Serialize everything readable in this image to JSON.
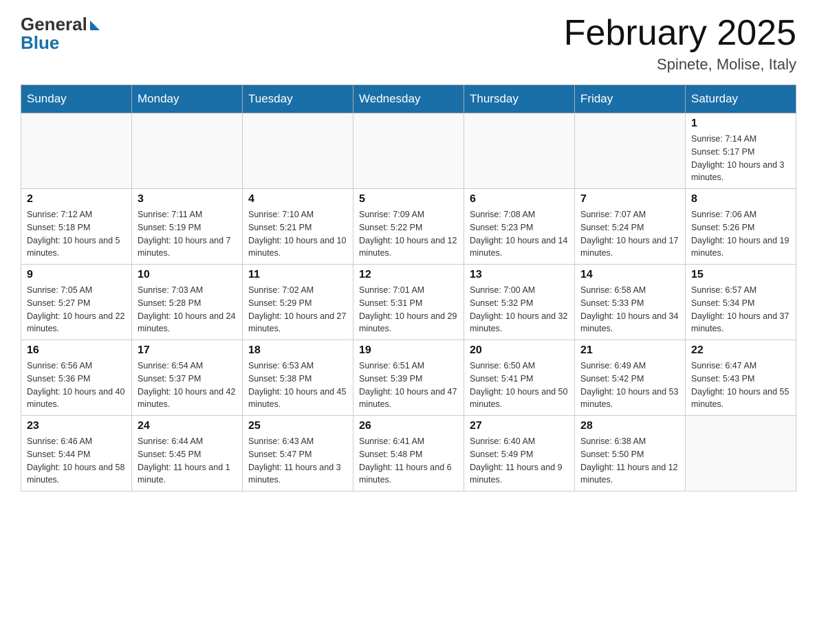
{
  "header": {
    "logo_general": "General",
    "logo_blue": "Blue",
    "month_title": "February 2025",
    "location": "Spinete, Molise, Italy"
  },
  "days_of_week": [
    "Sunday",
    "Monday",
    "Tuesday",
    "Wednesday",
    "Thursday",
    "Friday",
    "Saturday"
  ],
  "weeks": [
    [
      {
        "day": "",
        "info": ""
      },
      {
        "day": "",
        "info": ""
      },
      {
        "day": "",
        "info": ""
      },
      {
        "day": "",
        "info": ""
      },
      {
        "day": "",
        "info": ""
      },
      {
        "day": "",
        "info": ""
      },
      {
        "day": "1",
        "info": "Sunrise: 7:14 AM\nSunset: 5:17 PM\nDaylight: 10 hours and 3 minutes."
      }
    ],
    [
      {
        "day": "2",
        "info": "Sunrise: 7:12 AM\nSunset: 5:18 PM\nDaylight: 10 hours and 5 minutes."
      },
      {
        "day": "3",
        "info": "Sunrise: 7:11 AM\nSunset: 5:19 PM\nDaylight: 10 hours and 7 minutes."
      },
      {
        "day": "4",
        "info": "Sunrise: 7:10 AM\nSunset: 5:21 PM\nDaylight: 10 hours and 10 minutes."
      },
      {
        "day": "5",
        "info": "Sunrise: 7:09 AM\nSunset: 5:22 PM\nDaylight: 10 hours and 12 minutes."
      },
      {
        "day": "6",
        "info": "Sunrise: 7:08 AM\nSunset: 5:23 PM\nDaylight: 10 hours and 14 minutes."
      },
      {
        "day": "7",
        "info": "Sunrise: 7:07 AM\nSunset: 5:24 PM\nDaylight: 10 hours and 17 minutes."
      },
      {
        "day": "8",
        "info": "Sunrise: 7:06 AM\nSunset: 5:26 PM\nDaylight: 10 hours and 19 minutes."
      }
    ],
    [
      {
        "day": "9",
        "info": "Sunrise: 7:05 AM\nSunset: 5:27 PM\nDaylight: 10 hours and 22 minutes."
      },
      {
        "day": "10",
        "info": "Sunrise: 7:03 AM\nSunset: 5:28 PM\nDaylight: 10 hours and 24 minutes."
      },
      {
        "day": "11",
        "info": "Sunrise: 7:02 AM\nSunset: 5:29 PM\nDaylight: 10 hours and 27 minutes."
      },
      {
        "day": "12",
        "info": "Sunrise: 7:01 AM\nSunset: 5:31 PM\nDaylight: 10 hours and 29 minutes."
      },
      {
        "day": "13",
        "info": "Sunrise: 7:00 AM\nSunset: 5:32 PM\nDaylight: 10 hours and 32 minutes."
      },
      {
        "day": "14",
        "info": "Sunrise: 6:58 AM\nSunset: 5:33 PM\nDaylight: 10 hours and 34 minutes."
      },
      {
        "day": "15",
        "info": "Sunrise: 6:57 AM\nSunset: 5:34 PM\nDaylight: 10 hours and 37 minutes."
      }
    ],
    [
      {
        "day": "16",
        "info": "Sunrise: 6:56 AM\nSunset: 5:36 PM\nDaylight: 10 hours and 40 minutes."
      },
      {
        "day": "17",
        "info": "Sunrise: 6:54 AM\nSunset: 5:37 PM\nDaylight: 10 hours and 42 minutes."
      },
      {
        "day": "18",
        "info": "Sunrise: 6:53 AM\nSunset: 5:38 PM\nDaylight: 10 hours and 45 minutes."
      },
      {
        "day": "19",
        "info": "Sunrise: 6:51 AM\nSunset: 5:39 PM\nDaylight: 10 hours and 47 minutes."
      },
      {
        "day": "20",
        "info": "Sunrise: 6:50 AM\nSunset: 5:41 PM\nDaylight: 10 hours and 50 minutes."
      },
      {
        "day": "21",
        "info": "Sunrise: 6:49 AM\nSunset: 5:42 PM\nDaylight: 10 hours and 53 minutes."
      },
      {
        "day": "22",
        "info": "Sunrise: 6:47 AM\nSunset: 5:43 PM\nDaylight: 10 hours and 55 minutes."
      }
    ],
    [
      {
        "day": "23",
        "info": "Sunrise: 6:46 AM\nSunset: 5:44 PM\nDaylight: 10 hours and 58 minutes."
      },
      {
        "day": "24",
        "info": "Sunrise: 6:44 AM\nSunset: 5:45 PM\nDaylight: 11 hours and 1 minute."
      },
      {
        "day": "25",
        "info": "Sunrise: 6:43 AM\nSunset: 5:47 PM\nDaylight: 11 hours and 3 minutes."
      },
      {
        "day": "26",
        "info": "Sunrise: 6:41 AM\nSunset: 5:48 PM\nDaylight: 11 hours and 6 minutes."
      },
      {
        "day": "27",
        "info": "Sunrise: 6:40 AM\nSunset: 5:49 PM\nDaylight: 11 hours and 9 minutes."
      },
      {
        "day": "28",
        "info": "Sunrise: 6:38 AM\nSunset: 5:50 PM\nDaylight: 11 hours and 12 minutes."
      },
      {
        "day": "",
        "info": ""
      }
    ]
  ]
}
